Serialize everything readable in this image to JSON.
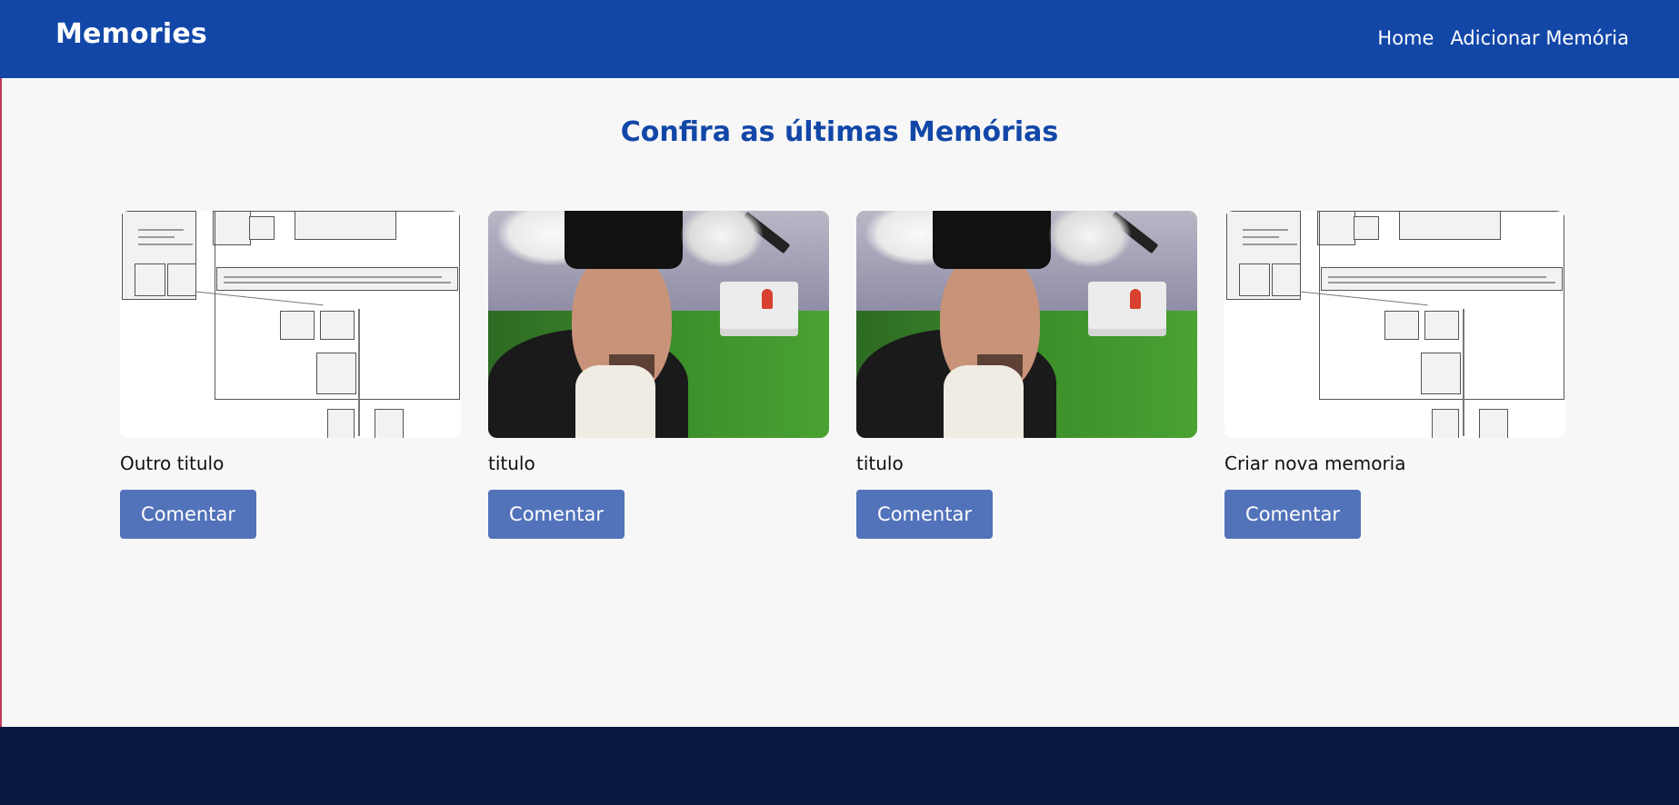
{
  "header": {
    "brand": "Memories",
    "nav": [
      {
        "label": "Home"
      },
      {
        "label": "Adicionar Memória"
      }
    ]
  },
  "main": {
    "heading": "Confira as últimas Memórias",
    "button_label": "Comentar",
    "cards": [
      {
        "title": "Outro titulo",
        "image": "class-diagram-image"
      },
      {
        "title": "titulo",
        "image": "graduation-selfie-image"
      },
      {
        "title": "titulo",
        "image": "graduation-selfie-image"
      },
      {
        "title": "Criar nova memoria",
        "image": "class-diagram-image"
      }
    ]
  },
  "colors": {
    "header_bg": "#1247a8",
    "heading": "#1247a8",
    "button_bg": "#5273ba",
    "footer_bg": "#061840",
    "page_bg": "#f7f7f7"
  }
}
